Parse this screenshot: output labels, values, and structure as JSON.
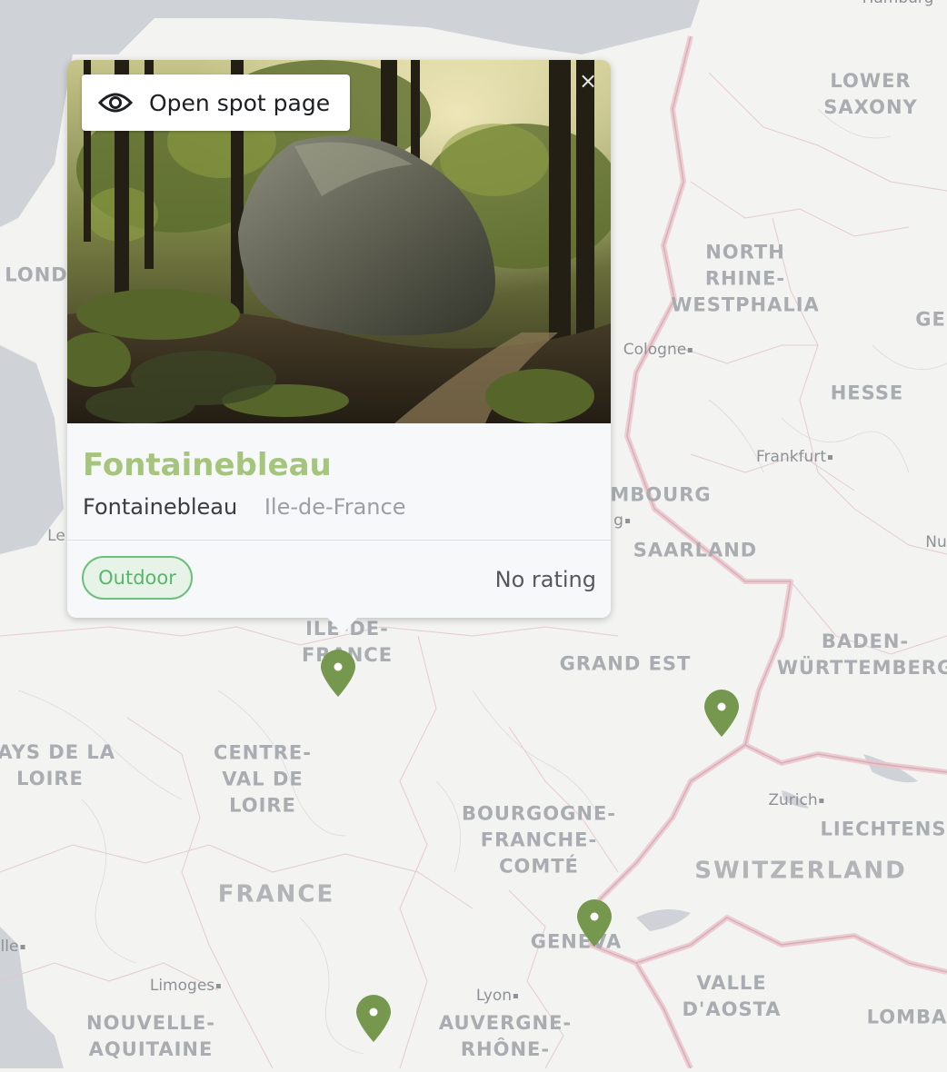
{
  "map": {
    "region_labels": [
      {
        "text": "LOWER\nSAXONY",
        "kind": "region"
      },
      {
        "text": "NORTH\nRHINE-\nWESTPHALIA",
        "kind": "region"
      },
      {
        "text": "HESSE",
        "kind": "region"
      },
      {
        "text": "SAARLAND",
        "kind": "region"
      },
      {
        "text": "MBOURG",
        "kind": "region"
      },
      {
        "text": "GE",
        "kind": "region"
      },
      {
        "text": "LOND",
        "kind": "region"
      },
      {
        "text": "ILE-DE-\nFRANCE",
        "kind": "region"
      },
      {
        "text": "GRAND EST",
        "kind": "region"
      },
      {
        "text": "BADEN-\nWÜRTTEMBERG",
        "kind": "region"
      },
      {
        "text": "PAYS DE LA\nLOIRE",
        "kind": "region"
      },
      {
        "text": "CENTRE-\nVAL DE\nLOIRE",
        "kind": "region"
      },
      {
        "text": "BOURGOGNE-\nFRANCHE-\nCOMTÉ",
        "kind": "region"
      },
      {
        "text": "LIECHTENS",
        "kind": "region"
      },
      {
        "text": "SWITZERLAND",
        "kind": "country"
      },
      {
        "text": "FRANCE",
        "kind": "country"
      },
      {
        "text": "GENEVA",
        "kind": "region"
      },
      {
        "text": "VALLE\nD'AOSTA",
        "kind": "region"
      },
      {
        "text": "LOMBA",
        "kind": "region"
      },
      {
        "text": "NOUVELLE-\nAQUITAINE",
        "kind": "region"
      },
      {
        "text": "AUVERGNE-\nRHÔNE-",
        "kind": "region"
      }
    ],
    "city_labels": [
      "Hamburg",
      "Cologne",
      "Frankfurt",
      "Zurich",
      "Lyon",
      "Limoges",
      "Le",
      "lle",
      "Nu",
      "g"
    ],
    "marker_color": "#76984e",
    "water_color": "#cfd2d6",
    "border_color": "#e7c5cb"
  },
  "popup": {
    "open_spot_label": "Open spot page",
    "close_symbol": "×",
    "title": "Fontainebleau",
    "city": "Fontainebleau",
    "region": "Ile-de-France",
    "tag": "Outdoor",
    "rating": "No rating",
    "title_color": "#a5c47c",
    "tag_color": "#58b668"
  }
}
